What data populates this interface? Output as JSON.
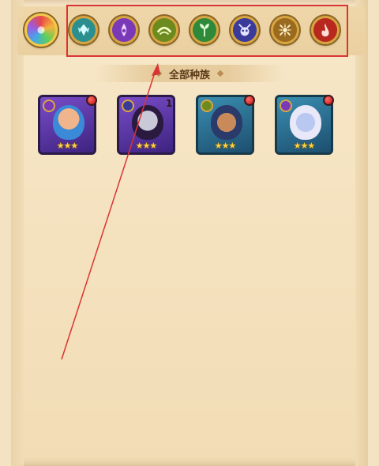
{
  "tabs": {
    "all_label": "全部种族"
  },
  "race_filters": [
    {
      "name": "all-races",
      "icon": "rainbow-swirl-icon",
      "color": "#e84848"
    },
    {
      "name": "forest",
      "icon": "wing-crest-icon",
      "color": "#2b8f8f"
    },
    {
      "name": "shadow",
      "icon": "mask-drop-icon",
      "color": "#7a3ab8"
    },
    {
      "name": "fortress",
      "icon": "arc-wave-icon",
      "color": "#6d8a1e"
    },
    {
      "name": "nature",
      "icon": "leaf-sprout-icon",
      "color": "#2e8a3a"
    },
    {
      "name": "abyss",
      "icon": "horned-skull-icon",
      "color": "#3a3a9a"
    },
    {
      "name": "light",
      "icon": "sun-flower-icon",
      "color": "#9a6a1e"
    },
    {
      "name": "dark",
      "icon": "flame-rune-icon",
      "color": "#b8281e"
    }
  ],
  "heroes": [
    {
      "name": "hero-blue-hair-mage",
      "faction": "shadow",
      "stars": "★★★",
      "has_red_dot": true,
      "count": ""
    },
    {
      "name": "hero-pale-witch",
      "faction": "abyss",
      "stars": "★★★",
      "has_red_dot": false,
      "count": "1"
    },
    {
      "name": "hero-warrior-chief",
      "faction": "fortress",
      "stars": "★★★",
      "has_red_dot": true,
      "count": ""
    },
    {
      "name": "hero-white-hair-elf",
      "faction": "shadow",
      "stars": "★★★",
      "has_red_dot": true,
      "count": ""
    }
  ]
}
